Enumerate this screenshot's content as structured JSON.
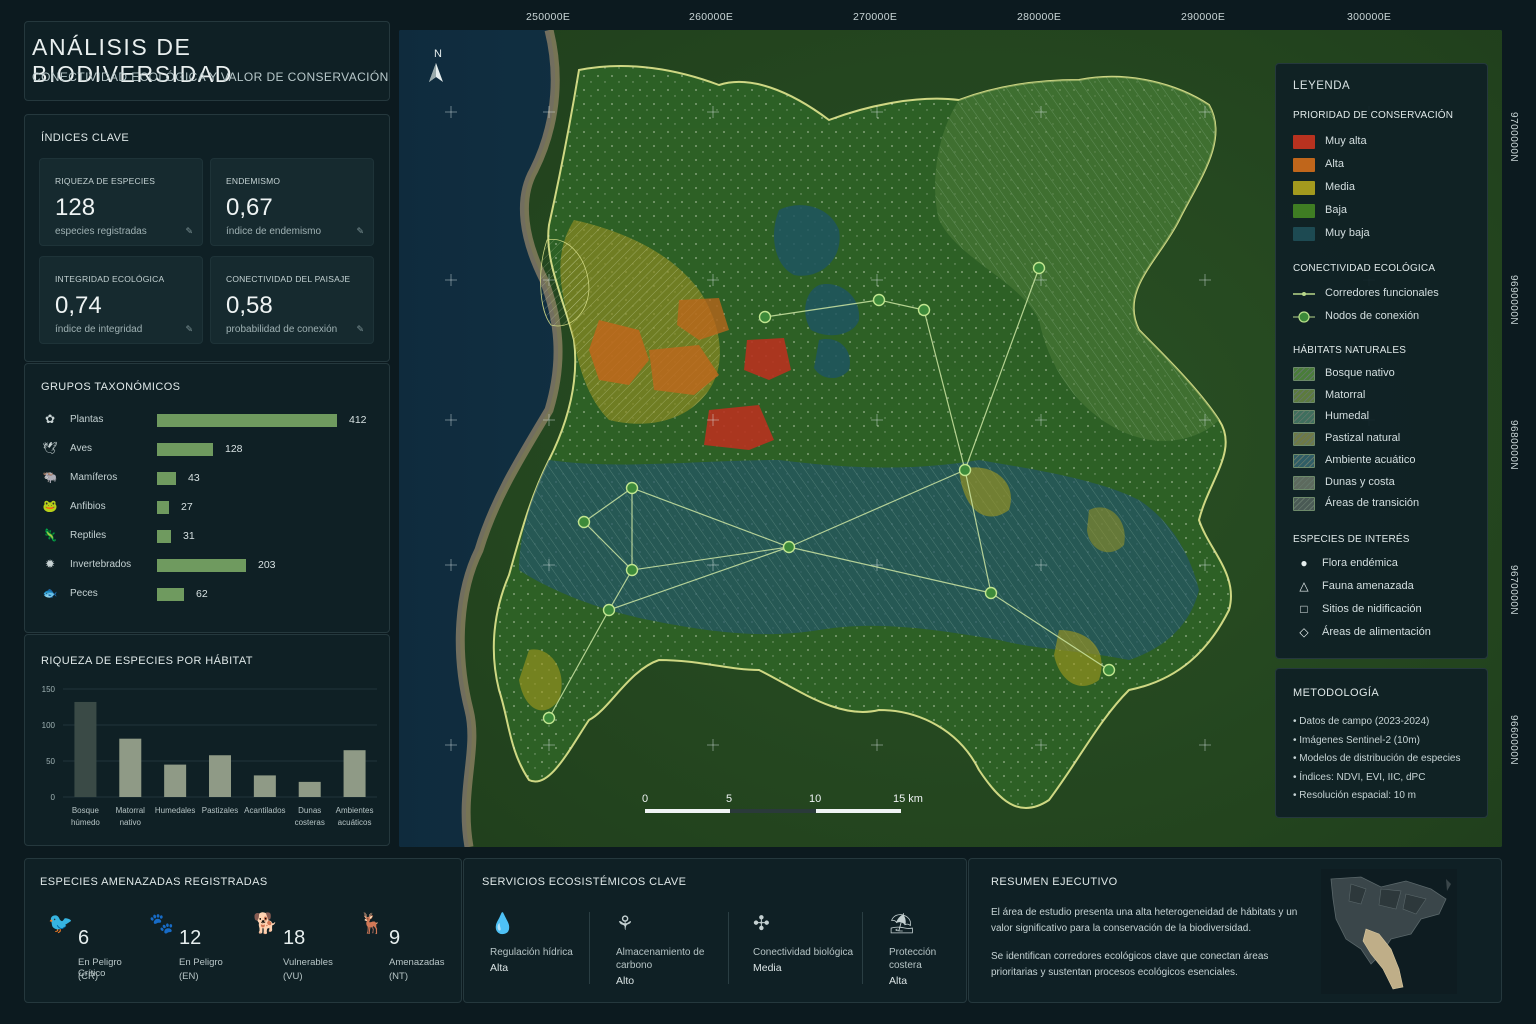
{
  "header": {
    "title": "ANÁLISIS DE BIODIVERSIDAD",
    "subtitle": "CONECTIVIDAD ECOLÓGICA Y VALOR DE CONSERVACIÓN"
  },
  "kpis": {
    "title": "ÍNDICES CLAVE",
    "cards": [
      {
        "label": "RIQUEZA DE ESPECIES",
        "value": "128",
        "sub": "especies registradas"
      },
      {
        "label": "ENDEMISMO",
        "value": "0,67",
        "sub": "índice de endemismo"
      },
      {
        "label": "INTEGRIDAD ECOLÓGICA",
        "value": "0,74",
        "sub": "índice de integridad"
      },
      {
        "label": "CONECTIVIDAD DEL PAISAJE",
        "value": "0,58",
        "sub": "probabilidad de conexión"
      }
    ]
  },
  "taxa": {
    "title": "GRUPOS TAXONÓMICOS",
    "bar_color": "#6f9a5f",
    "items": [
      {
        "name": "Plantas",
        "count": 412,
        "icon": "plant-icon"
      },
      {
        "name": "Aves",
        "count": 128,
        "icon": "bird-icon"
      },
      {
        "name": "Mamíferos",
        "count": 43,
        "icon": "mammal-icon"
      },
      {
        "name": "Anfibios",
        "count": 27,
        "icon": "frog-icon"
      },
      {
        "name": "Reptiles",
        "count": 31,
        "icon": "reptile-icon"
      },
      {
        "name": "Invertebrados",
        "count": 203,
        "icon": "insect-icon"
      },
      {
        "name": "Peces",
        "count": 62,
        "icon": "fish-icon"
      }
    ]
  },
  "richness_panel": {
    "title": "RIQUEZA DE ESPECIES POR HÁBITAT"
  },
  "chart_data": {
    "type": "bar",
    "title": "RIQUEZA DE ESPECIES POR HÁBITAT",
    "categories": [
      "Bosque húmedo",
      "Matorral nativo",
      "Humedales",
      "Pastizales",
      "Acantilados",
      "Dunas costeras",
      "Ambientes acuáticos"
    ],
    "values": [
      132,
      81,
      45,
      58,
      30,
      21,
      65
    ],
    "ylim": [
      0,
      150
    ],
    "yticks": [
      0,
      50,
      100,
      150
    ],
    "grid": true,
    "colors": [
      "#3a4a46",
      "#8f9a86",
      "#8f9a86",
      "#8f9a86",
      "#8f9a86",
      "#8f9a86",
      "#8f9a86"
    ]
  },
  "map": {
    "north_label": "N",
    "coords_top": [
      "250000E",
      "260000E",
      "270000E",
      "280000E",
      "290000E",
      "300000E"
    ],
    "coords_right": [
      "9700000N",
      "9690000N",
      "9680000N",
      "9670000N",
      "9660000N"
    ],
    "scale_labels": [
      "0",
      "5",
      "10",
      "15 km"
    ]
  },
  "legend": {
    "title": "LEYENDA",
    "priority_title": "PRIORIDAD DE CONSERVACIÓN",
    "priority": [
      {
        "label": "Muy alta",
        "color": "#b8321f"
      },
      {
        "label": "Alta",
        "color": "#c0661b"
      },
      {
        "label": "Media",
        "color": "#a39a1e"
      },
      {
        "label": "Baja",
        "color": "#3f7d23"
      },
      {
        "label": "Muy baja",
        "color": "#1d4a52"
      }
    ],
    "connectivity_title": "CONECTIVIDAD ECOLÓGICA",
    "connectivity": [
      {
        "label": "Corredores funcionales"
      },
      {
        "label": "Nodos de conexión"
      }
    ],
    "habitats_title": "HÁBITATS NATURALES",
    "habitats": [
      {
        "label": "Bosque nativo",
        "color": "#4a7d3a"
      },
      {
        "label": "Matorral",
        "color": "#5d7b3e"
      },
      {
        "label": "Humedal",
        "color": "#3f6f5e"
      },
      {
        "label": "Pastizal natural",
        "color": "#6f7a46"
      },
      {
        "label": "Ambiente acuático",
        "color": "#2f5d66"
      },
      {
        "label": "Dunas y costa",
        "color": "#5d6a5e"
      },
      {
        "label": "Áreas de transición",
        "color": "#4a5a55"
      }
    ],
    "species_title": "ESPECIES DE INTERÉS",
    "species": [
      {
        "label": "Flora endémica",
        "icon": "circle-icon",
        "glyph": "●"
      },
      {
        "label": "Fauna amenazada",
        "icon": "triangle-icon",
        "glyph": "△"
      },
      {
        "label": "Sitios de nidificación",
        "icon": "square-icon",
        "glyph": "□"
      },
      {
        "label": "Áreas de alimentación",
        "icon": "diamond-icon",
        "glyph": "◇"
      }
    ]
  },
  "methodology": {
    "title": "METODOLOGÍA",
    "items": [
      "Datos de campo (2023-2024)",
      "Imágenes Sentinel-2 (10m)",
      "Modelos de distribución de especies",
      "Índices: NDVI, EVI, IIC, dPC",
      "Resolución espacial: 10 m"
    ]
  },
  "threatened": {
    "title": "ESPECIES AMENAZADAS REGISTRADAS",
    "items": [
      {
        "count": "6",
        "category": "En Peligro Crítico",
        "code": "(CR)"
      },
      {
        "count": "12",
        "category": "En Peligro",
        "code": "(EN)"
      },
      {
        "count": "18",
        "category": "Vulnerables",
        "code": "(VU)"
      },
      {
        "count": "9",
        "category": "Amenazadas",
        "code": "(NT)"
      }
    ]
  },
  "ecosystem": {
    "title": "SERVICIOS ECOSISTÉMICOS CLAVE",
    "items": [
      {
        "name": "Regulación hídrica",
        "level": "Alta",
        "icon": "water-drop-icon",
        "glyph": "💧"
      },
      {
        "name": "Almacenamiento de carbono",
        "level": "Alto",
        "icon": "carbon-icon",
        "glyph": "⚘"
      },
      {
        "name": "Conectividad biológica",
        "level": "Media",
        "icon": "network-icon",
        "glyph": "✣"
      },
      {
        "name": "Protección costera",
        "level": "Alta",
        "icon": "coast-icon",
        "glyph": "⛱"
      }
    ]
  },
  "summary": {
    "title": "RESUMEN EJECUTIVO",
    "p1": "El área de estudio presenta una alta heterogeneidad de hábitats y un valor significativo para la conservación de la biodiversidad.",
    "p2": "Se identifican corredores ecológicos clave que conectan áreas prioritarias y sustentan procesos ecológicos esenciales."
  }
}
